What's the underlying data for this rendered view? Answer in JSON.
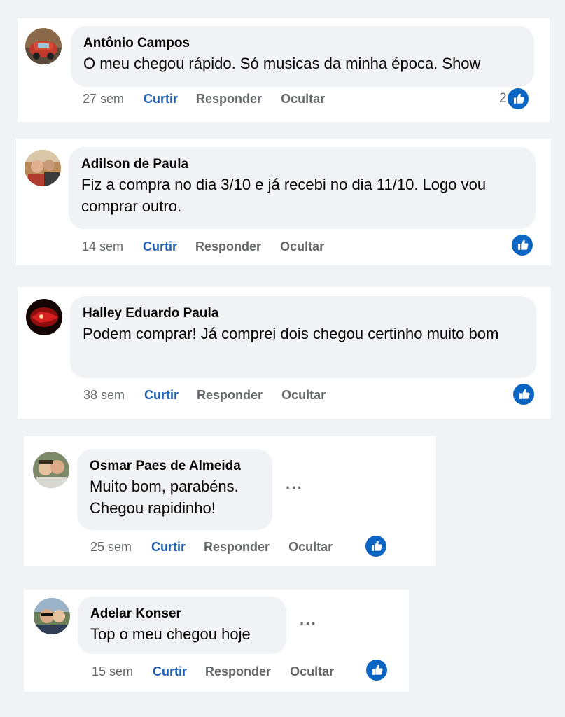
{
  "comments": [
    {
      "author": "Antônio Campos",
      "text": "O meu chegou rápido. Só musicas da minha época. Show",
      "time": "27 sem",
      "like": "Curtir",
      "reply": "Responder",
      "hide": "Ocultar",
      "reactions": "2",
      "reaction_icon": "thumbs-up-icon"
    },
    {
      "author": "Adilson de Paula",
      "text": "Fiz a compra no dia 3/10 e já recebi no dia 11/10. Logo vou comprar outro.",
      "time": "14 sem",
      "like": "Curtir",
      "reply": "Responder",
      "hide": "Ocultar",
      "reaction_icon": "thumbs-up-icon"
    },
    {
      "author": "Halley Eduardo Paula",
      "text": "Podem comprar! Já comprei dois chegou certinho muito bom",
      "time": "38 sem",
      "like": "Curtir",
      "reply": "Responder",
      "hide": "Ocultar",
      "reaction_icon": "thumbs-up-icon"
    },
    {
      "author": "Osmar Paes de Almeida",
      "text": "Muito bom, parabéns. Chegou rapidinho!",
      "time": "25 sem",
      "like": "Curtir",
      "reply": "Responder",
      "hide": "Ocultar",
      "more": "···",
      "reaction_icon": "thumbs-up-icon"
    },
    {
      "author": "Adelar Konser",
      "text": "Top o meu chegou hoje",
      "time": "15 sem",
      "like": "Curtir",
      "reply": "Responder",
      "hide": "Ocultar",
      "more": "···",
      "reaction_icon": "thumbs-up-icon"
    }
  ],
  "colors": {
    "page_bg": "#f0f2f5",
    "card_bg": "#ffffff",
    "bubble_bg": "#f0f2f5",
    "like_blue": "#1f5fb6",
    "reaction_blue": "#0a66c2",
    "muted_text": "#65676b"
  }
}
